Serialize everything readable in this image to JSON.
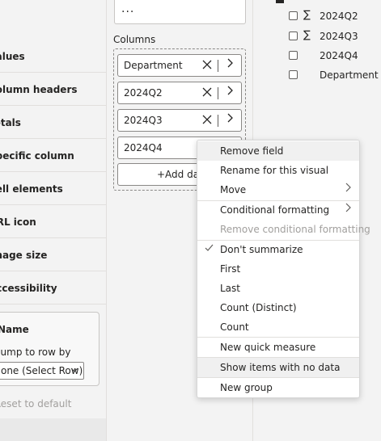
{
  "format_pane": {
    "items": [
      "Values",
      "Column headers",
      "Totals",
      "Specific column",
      "Cell elements",
      "URL icon",
      "Image size",
      "Accessibility"
    ],
    "card_title": "Name",
    "card_label": "Jump to row by",
    "select_value": "None (Select Row)",
    "reset_label": "Reset to default"
  },
  "viz_pane": {
    "top_field_text": "...",
    "columns_label": "Columns",
    "pills": [
      "Department",
      "2024Q2",
      "2024Q3",
      "2024Q4"
    ],
    "add_label": "+Add data"
  },
  "data_pane": {
    "fields": [
      {
        "label": "2024Q2",
        "sigma": true
      },
      {
        "label": "2024Q3",
        "sigma": true
      },
      {
        "label": "2024Q4",
        "sigma": false
      },
      {
        "label": "Department",
        "sigma": false
      }
    ]
  },
  "context_menu": {
    "remove_field": "Remove field",
    "rename": "Rename for this visual",
    "move": "Move",
    "conditional_formatting": "Conditional formatting",
    "remove_conditional_formatting": "Remove conditional formatting",
    "dont_summarize": "Don't summarize",
    "first": "First",
    "last": "Last",
    "count_distinct": "Count (Distinct)",
    "count": "Count",
    "new_quick_measure": "New quick measure",
    "show_items_no_data": "Show items with no data",
    "new_group": "New group"
  }
}
